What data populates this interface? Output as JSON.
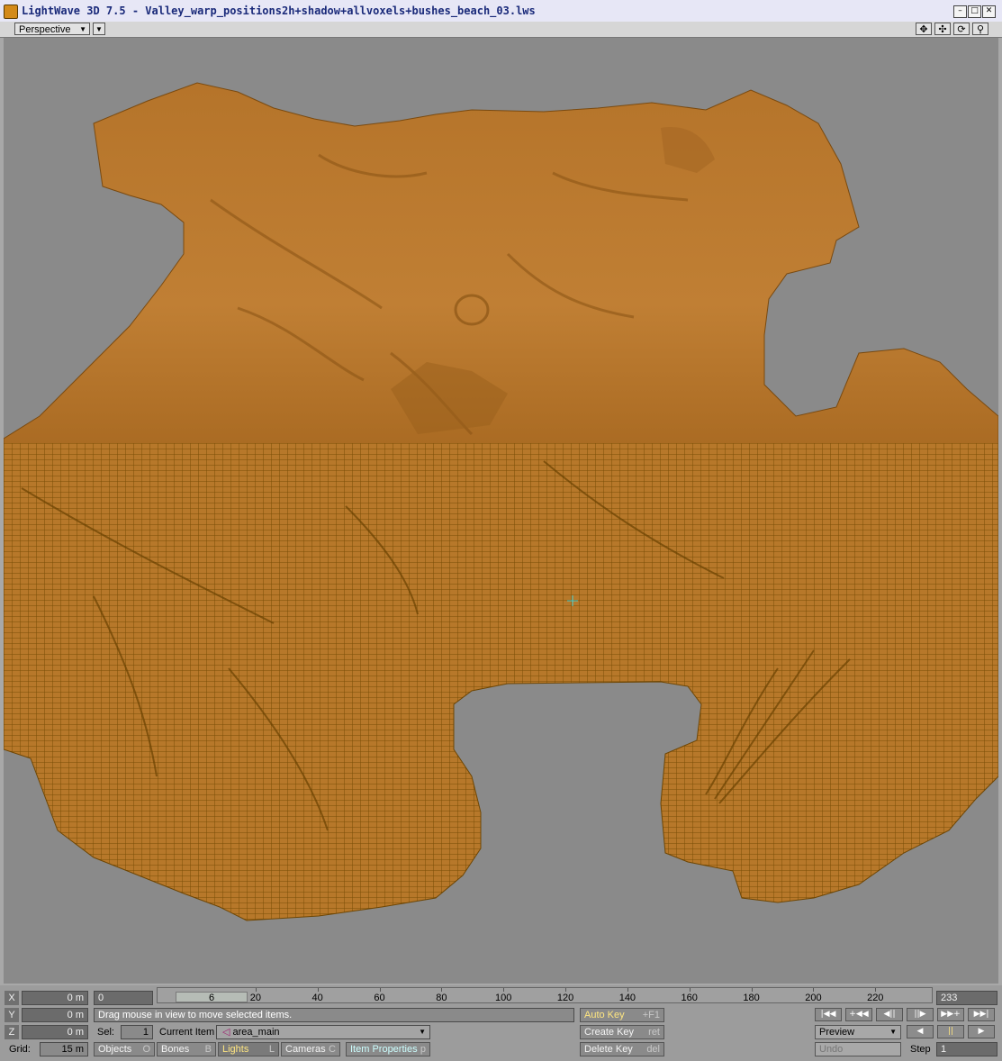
{
  "window": {
    "title": "LightWave 3D 7.5 - Valley_warp_positions2h+shadow+allvoxels+bushes_beach_03.lws",
    "minimize_icon": "minimize-icon",
    "maximize_icon": "maximize-icon",
    "close_icon": "close-icon"
  },
  "viewport": {
    "view_mode": "Perspective",
    "tools": [
      "move-view-icon",
      "pan-view-icon",
      "rotate-view-icon",
      "zoom-view-icon"
    ],
    "colors": {
      "background": "#8a8a8a",
      "terrain": "#b7782a",
      "wireframe": "#8a5a08"
    }
  },
  "coords": {
    "x_label": "X",
    "x_value": "0 m",
    "y_label": "Y",
    "y_value": "0 m",
    "z_label": "Z",
    "z_value": "0 m",
    "grid_label": "Grid:",
    "grid_value": "15 m"
  },
  "timeline": {
    "current_frame": "0",
    "slider_frame": "6",
    "ticks": [
      "20",
      "40",
      "60",
      "80",
      "100",
      "120",
      "140",
      "160",
      "180",
      "200",
      "220"
    ],
    "end_frame": "233"
  },
  "status": {
    "message": "Drag mouse in view to move selected items.",
    "sel_label": "Sel:",
    "sel_value": "1",
    "current_item_label": "Current Item",
    "current_item_value": "area_main"
  },
  "item_buttons": [
    {
      "label": "Objects",
      "hotkey": "O"
    },
    {
      "label": "Bones",
      "hotkey": "B"
    },
    {
      "label": "Lights",
      "hotkey": "L"
    },
    {
      "label": "Cameras",
      "hotkey": "C"
    },
    {
      "label": "Item Properties",
      "hotkey": "p"
    }
  ],
  "keys": {
    "auto_key": "Auto Key",
    "auto_key_hotkey": "+F1",
    "create_key": "Create Key",
    "create_key_hotkey": "ret",
    "delete_key": "Delete Key",
    "delete_key_hotkey": "del"
  },
  "transport": {
    "buttons": [
      "first-frame-icon",
      "step-back-key-icon",
      "prev-frame-icon",
      "next-frame-icon",
      "step-forward-key-icon",
      "last-frame-icon"
    ],
    "preview_label": "Preview",
    "undo_label": "Undo",
    "step_label": "Step",
    "step_value": "1"
  }
}
